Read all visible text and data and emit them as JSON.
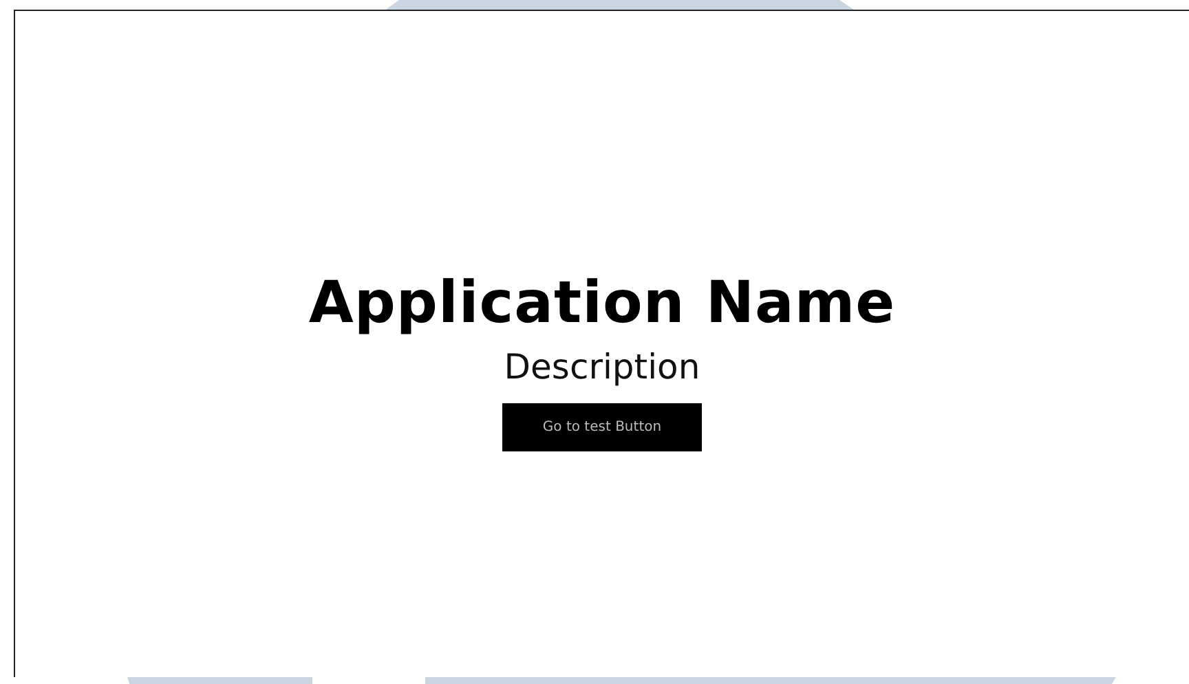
{
  "title": "Application Name",
  "description": "Description",
  "button": {
    "label": "Go to test Button"
  }
}
